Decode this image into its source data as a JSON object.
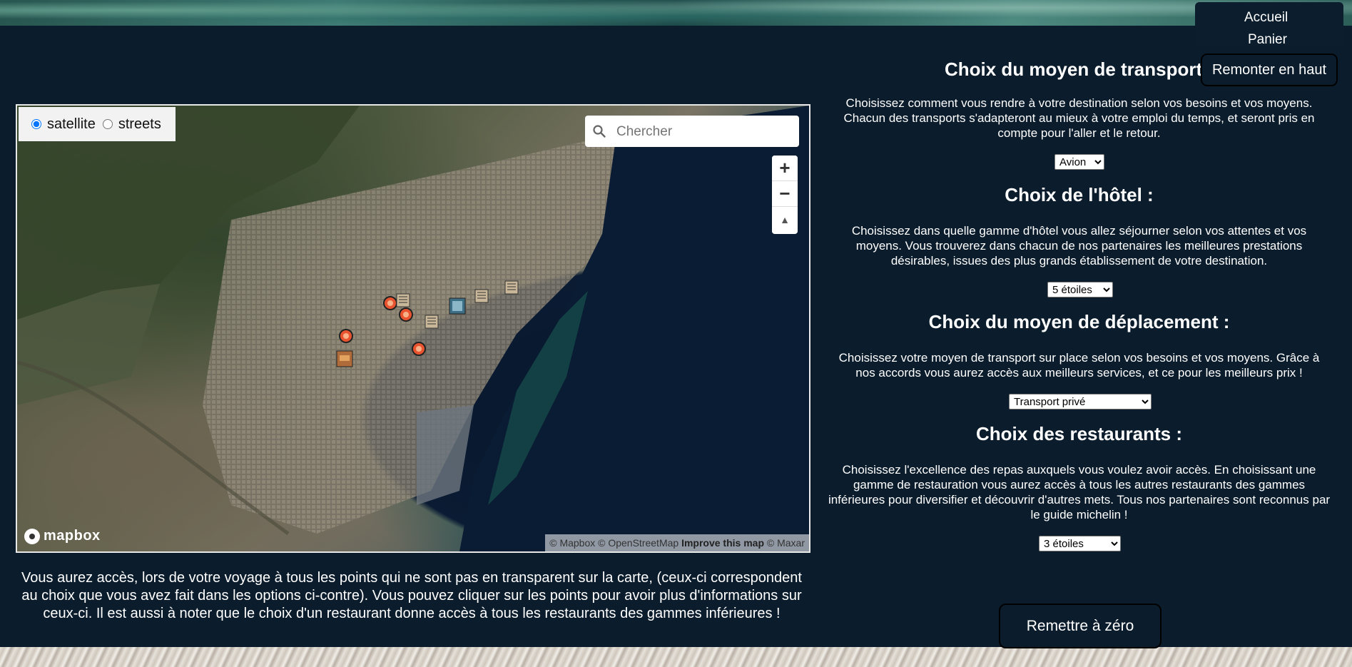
{
  "nav": {
    "home": "Accueil",
    "cart": "Panier",
    "back_to_top": "Remonter en haut"
  },
  "map": {
    "layers": [
      "satellite",
      "streets"
    ],
    "selected_layer": "satellite",
    "search_placeholder": "Chercher",
    "zoom_in": "+",
    "zoom_out": "−",
    "compass": "▲",
    "logo_text": "mapbox",
    "attribution_1": "© Mapbox © OpenStreetMap",
    "attribution_improve": "Improve this map",
    "attribution_2": "© Maxar",
    "note": "Vous aurez accès, lors de votre voyage à tous les points qui ne sont pas en transparent sur la carte, (ceux-ci correspondent au choix que vous avez fait dans les options ci-contre). Vous pouvez cliquer sur les points pour avoir plus d'informations sur ceux-ci. Il est aussi à noter que le choix d'un restaurant donne accès à tous les restaurants des gammes inférieures !"
  },
  "sections": {
    "transport": {
      "title": "Choix du moyen de transport :",
      "text": "Choisissez comment vous rendre à votre destination selon vos besoins et vos moyens. Chacun des transports s'adapteront au mieux à votre emploi du temps, et seront pris en compte pour l'aller et le retour.",
      "selected": "Avion"
    },
    "hotel": {
      "title": "Choix de l'hôtel :",
      "text": "Choisissez dans quelle gamme d'hôtel vous allez séjourner selon vos attentes et vos moyens. Vous trouverez dans chacun de nos partenaires les meilleures prestations désirables, issues des plus grands établissement de votre destination.",
      "selected": "5 étoiles"
    },
    "deplacement": {
      "title": "Choix du moyen de déplacement :",
      "text": "Choisissez votre moyen de transport sur place selon vos besoins et vos moyens. Grâce à nos accords vous aurez accès aux meilleurs services, et ce pour les meilleurs prix !",
      "selected": "Transport privé"
    },
    "restaurants": {
      "title": "Choix des restaurants :",
      "text": "Choisissez l'excellence des repas auxquels vous voulez avoir accès. En choisissant une gamme de restauration vous aurez accès à tous les autres restaurants des gammes inférieures pour diversifier et découvrir d'autres mets. Tous nos partenaires sont reconnus par le guide michelin !",
      "selected": "3 étoiles"
    }
  },
  "reset_label": "Remettre à zéro"
}
